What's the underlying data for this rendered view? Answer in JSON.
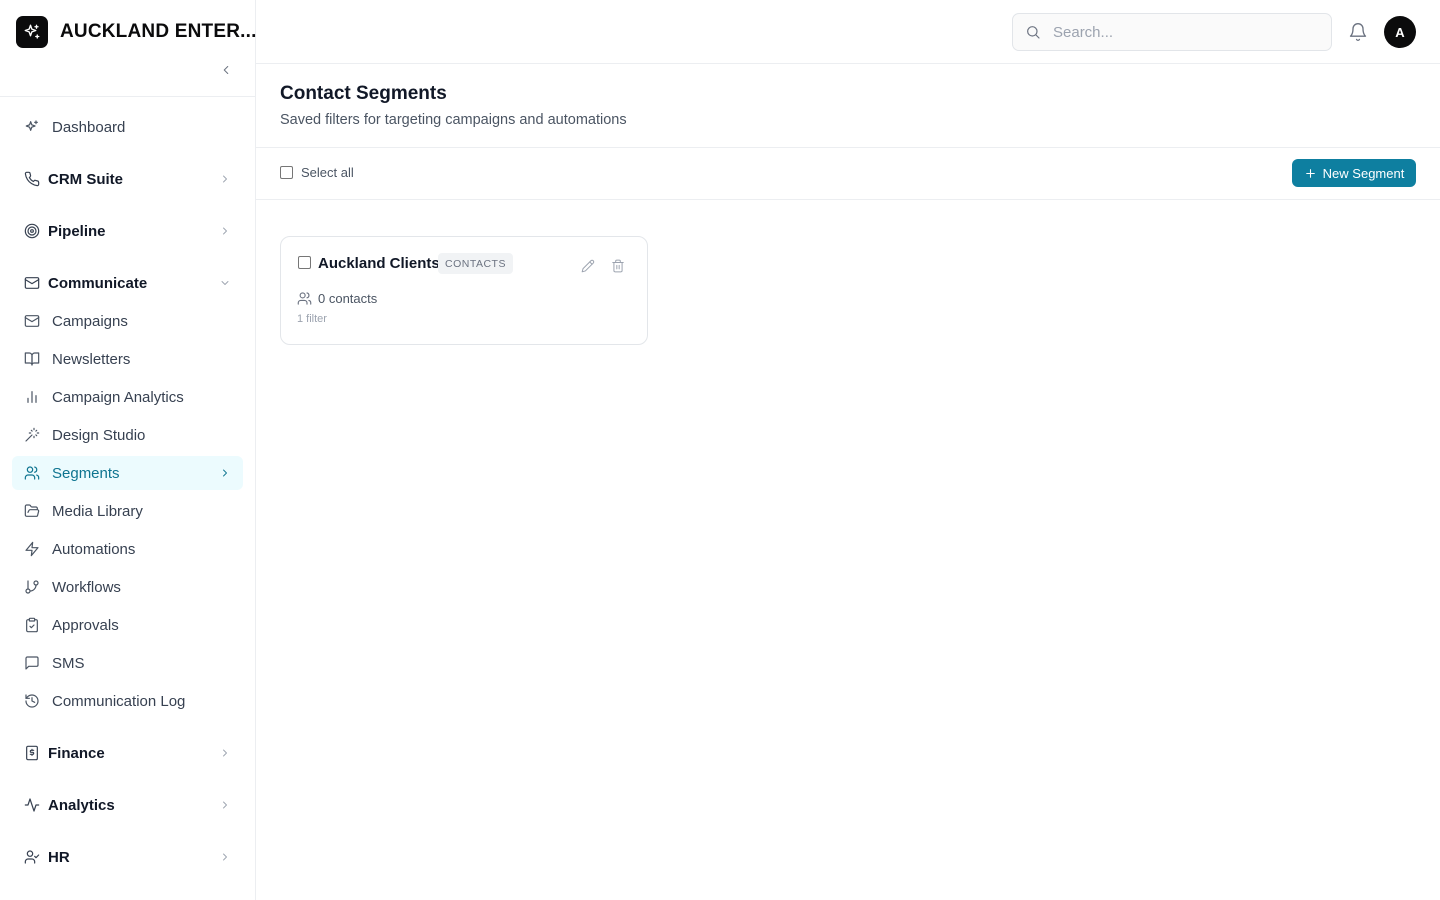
{
  "brand": {
    "name": "AUCKLAND ENTER..."
  },
  "colors": {
    "accent": "#0e7fa0",
    "active_text": "#0e7490",
    "active_bg": "#ecfbfe"
  },
  "sidebar": {
    "collapse_icon": "chevron-left-icon",
    "items": [
      {
        "label": "Dashboard",
        "icon": "sparkle-icon"
      },
      {
        "label": "CRM Suite",
        "icon": "phone-icon",
        "section": true,
        "expanded": false
      },
      {
        "label": "Pipeline",
        "icon": "target-icon",
        "section": true,
        "expanded": false
      },
      {
        "label": "Communicate",
        "icon": "mail-icon",
        "section": true,
        "expanded": true
      },
      {
        "label": "Campaigns",
        "icon": "mail-icon"
      },
      {
        "label": "Newsletters",
        "icon": "book-open-icon"
      },
      {
        "label": "Campaign Analytics",
        "icon": "bar-chart-icon"
      },
      {
        "label": "Design Studio",
        "icon": "wand-icon"
      },
      {
        "label": "Segments",
        "icon": "users-icon",
        "active": true
      },
      {
        "label": "Media Library",
        "icon": "folder-open-icon"
      },
      {
        "label": "Automations",
        "icon": "zap-icon"
      },
      {
        "label": "Workflows",
        "icon": "git-branch-icon"
      },
      {
        "label": "Approvals",
        "icon": "clipboard-check-icon"
      },
      {
        "label": "SMS",
        "icon": "message-square-icon"
      },
      {
        "label": "Communication Log",
        "icon": "history-icon"
      },
      {
        "label": "Finance",
        "icon": "receipt-icon",
        "section": true,
        "expanded": false
      },
      {
        "label": "Analytics",
        "icon": "activity-icon",
        "section": true,
        "expanded": false
      },
      {
        "label": "HR",
        "icon": "user-check-icon",
        "section": true,
        "expanded": false
      }
    ]
  },
  "topbar": {
    "search": {
      "placeholder": "Search...",
      "value": ""
    },
    "avatar_initial": "A"
  },
  "page": {
    "title": "Contact Segments",
    "subtitle": "Saved filters for targeting campaigns and automations"
  },
  "toolbar": {
    "select_all_label": "Select all",
    "new_button_label": "New Segment"
  },
  "segments": [
    {
      "name": "Auckland Clients",
      "type": "CONTACTS",
      "contacts": "0 contacts",
      "filters": "1 filter"
    }
  ]
}
